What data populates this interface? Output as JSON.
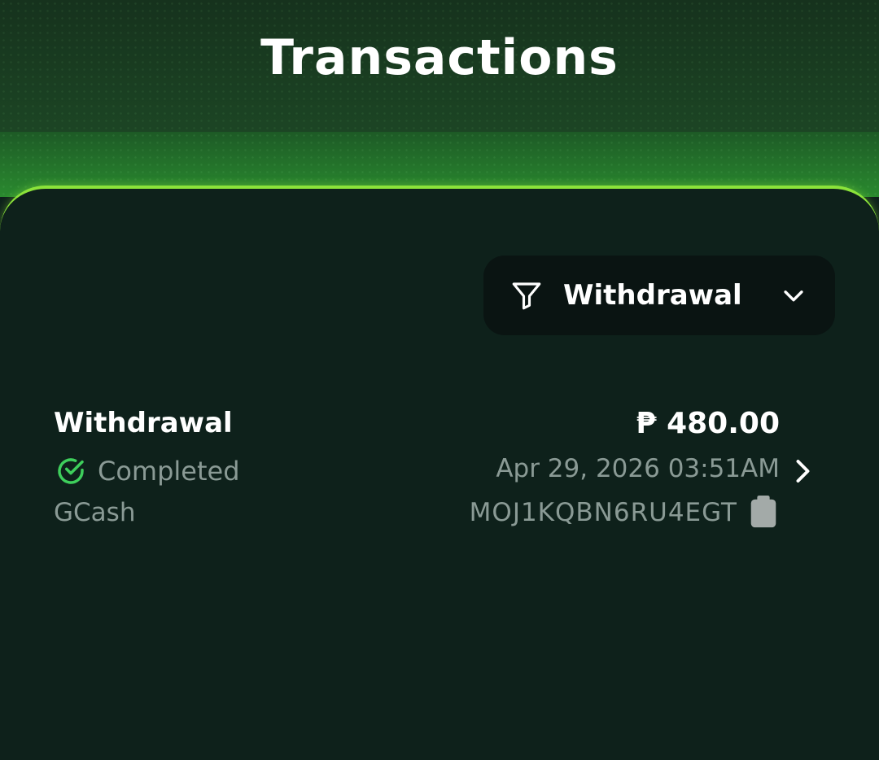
{
  "header": {
    "title": "Transactions"
  },
  "filter": {
    "icon": "funnel-icon",
    "selected": "Withdrawal",
    "dropdown_icon": "chevron-down-icon"
  },
  "transactions": [
    {
      "type": "Withdrawal",
      "status": "Completed",
      "status_icon": "check-circle-icon",
      "method": "GCash",
      "amount": "₱ 480.00",
      "datetime": "Apr 29, 2026 03:51AM",
      "reference": "MOJ1KQBN6RU4EGT",
      "copy_icon": "clipboard-icon",
      "detail_icon": "chevron-right-icon"
    }
  ],
  "colors": {
    "accent": "#8be33a",
    "success": "#3ecf5c",
    "panel_bg": "#0e211b",
    "muted_text": "#8a9a95"
  }
}
